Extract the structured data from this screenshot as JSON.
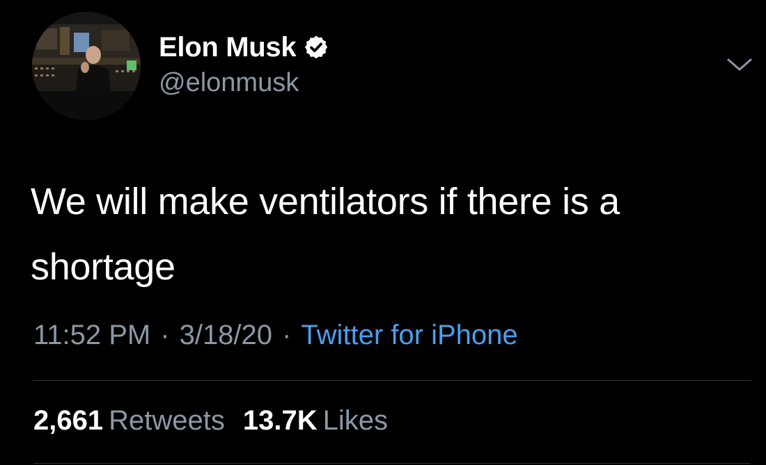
{
  "tweet": {
    "author": {
      "display_name": "Elon Musk",
      "handle": "@elonmusk",
      "verified_icon": "verified-badge-icon"
    },
    "text_line1": "We will make ventilators if there is a",
    "text_line2": "shortage",
    "time": "11:52 PM",
    "date": "3/18/20",
    "separator": "·",
    "source": "Twitter for iPhone",
    "stats": {
      "retweets_count": "2,661",
      "retweets_label": "Retweets",
      "likes_count": "13.7K",
      "likes_label": "Likes"
    },
    "menu_icon": "chevron-down-icon"
  },
  "colors": {
    "background": "#000000",
    "text_primary": "#ffffff",
    "text_secondary": "#8b98a5",
    "link": "#4a9ff0",
    "divider": "#2f3336"
  }
}
